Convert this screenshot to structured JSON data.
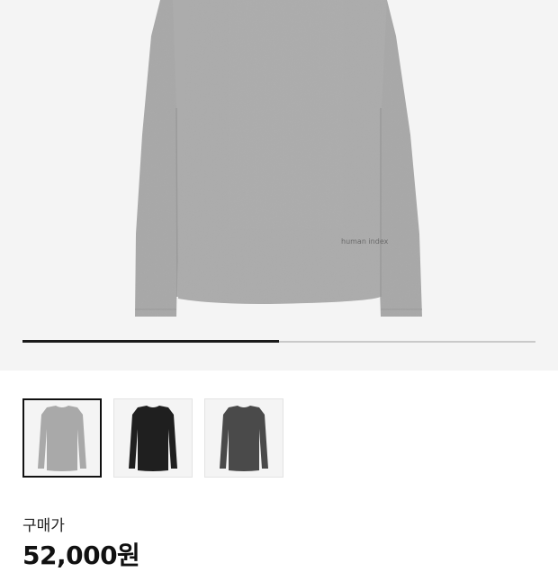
{
  "product": {
    "print_text": "human index",
    "colors": {
      "background": "#f4f4f4",
      "shirt_light": "#a9a9a9",
      "shirt_black": "#1f1f1f",
      "shirt_charcoal": "#4a4a4a",
      "selected_border": "#111111"
    }
  },
  "gallery": {
    "progress": 0.5,
    "thumbnails": [
      {
        "color": "light-gray",
        "selected": true
      },
      {
        "color": "black",
        "selected": false
      },
      {
        "color": "charcoal",
        "selected": false
      }
    ]
  },
  "price": {
    "label": "구매가",
    "value": "52,000원"
  }
}
